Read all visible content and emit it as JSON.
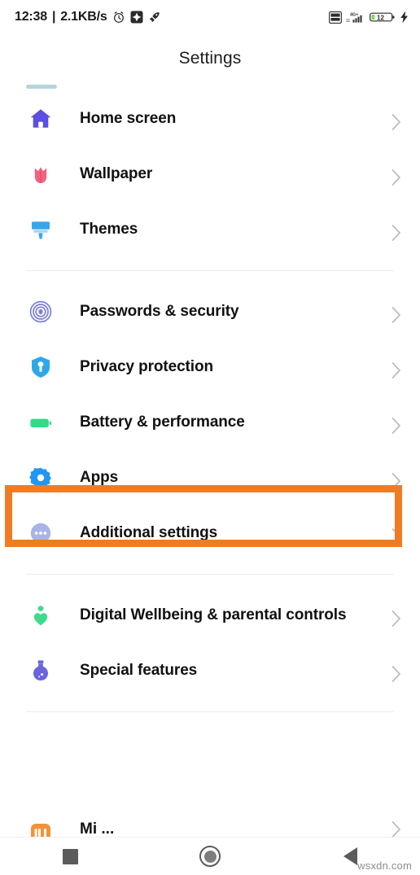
{
  "statusbar": {
    "time": "12:38",
    "separator": "|",
    "network_speed": "2.1KB/s",
    "left_icons": [
      "alarm-clock-icon",
      "app-badge-icon",
      "rocket-icon"
    ],
    "right_icons": [
      "vowifi-lte-icon",
      "signal-4g-plus-icon",
      "battery-icon",
      "charging-bolt-icon"
    ],
    "signal_label": "4G+",
    "battery_level": "12"
  },
  "header": {
    "title": "Settings"
  },
  "groups": [
    {
      "name": "personalization",
      "items": [
        {
          "label": "Home screen",
          "icon": "home-icon",
          "color": "#5b4fe0"
        },
        {
          "label": "Wallpaper",
          "icon": "tulip-icon",
          "color": "#f2637f"
        },
        {
          "label": "Themes",
          "icon": "paintbrush-icon",
          "color": "#3aa5e8"
        }
      ]
    },
    {
      "name": "system",
      "items": [
        {
          "label": "Passwords & security",
          "icon": "fingerprint-icon",
          "color": "#7b7fd4"
        },
        {
          "label": "Privacy protection",
          "icon": "shield-icon",
          "color": "#2fa8e8"
        },
        {
          "label": "Battery & performance",
          "icon": "battery-icon",
          "color": "#34d98a"
        },
        {
          "label": "Apps",
          "icon": "gear-icon",
          "color": "#2196f3",
          "highlighted": true
        },
        {
          "label": "Additional settings",
          "icon": "more-dots-icon",
          "color": "#a8b4e8"
        }
      ]
    },
    {
      "name": "wellbeing",
      "items": [
        {
          "label": "Digital Wellbeing & parental controls",
          "icon": "heart-person-icon",
          "color": "#3ddc8c"
        },
        {
          "label": "Special features",
          "icon": "potion-icon",
          "color": "#6b63e0"
        }
      ]
    }
  ],
  "cut_off_item": {
    "label": "Mi ...",
    "icon": "mi-account-icon",
    "color": "#f29338"
  },
  "highlight": {
    "color": "#ef7c23",
    "target_label": "Apps"
  },
  "navbar": {
    "buttons": [
      {
        "name": "recents-button",
        "icon": "square-icon"
      },
      {
        "name": "home-button",
        "icon": "circle-icon"
      },
      {
        "name": "back-button",
        "icon": "triangle-left-icon"
      }
    ]
  },
  "watermark": {
    "text": "wsxdn.com"
  }
}
